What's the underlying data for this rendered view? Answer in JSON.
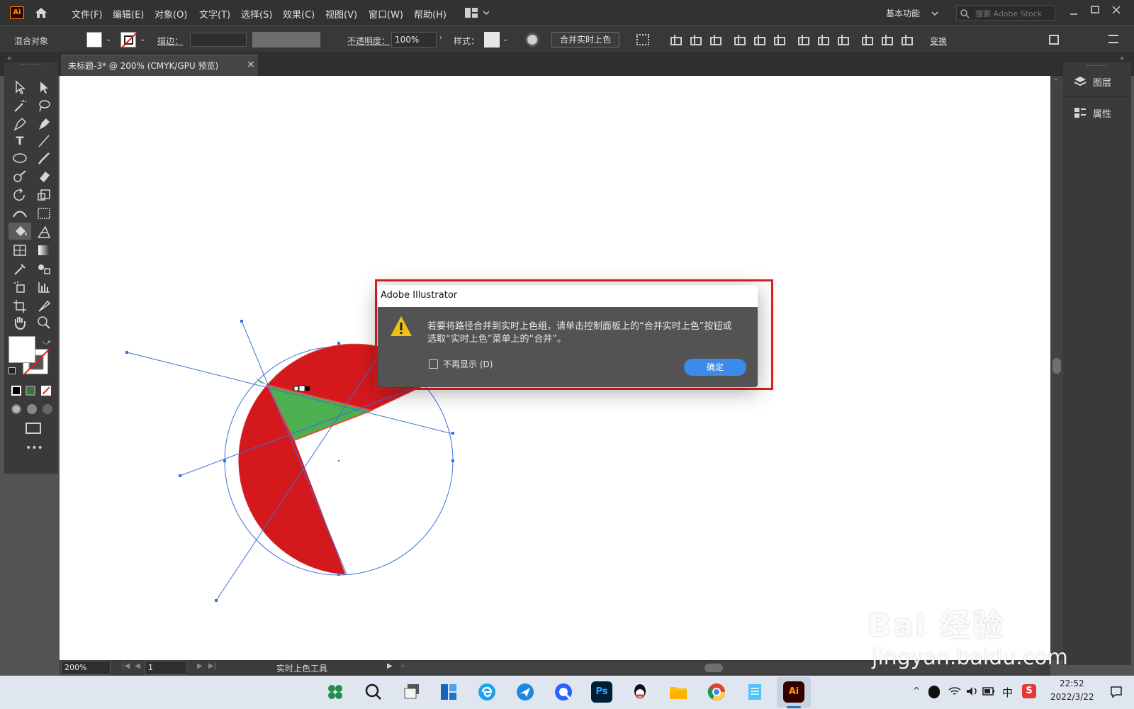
{
  "app": {
    "logo": "Ai",
    "workspace": "基本功能",
    "search_placeholder": "搜索 Adobe Stock"
  },
  "menu": [
    "文件(F)",
    "编辑(E)",
    "对象(O)",
    "文字(T)",
    "选择(S)",
    "效果(C)",
    "视图(V)",
    "窗口(W)",
    "帮助(H)"
  ],
  "control_bar": {
    "object_type": "混合对象",
    "stroke_label": "描边：",
    "opacity_label": "不透明度：",
    "opacity_value": "100%",
    "style_label": "样式：",
    "merge_button": "合并实时上色",
    "transform_label": "变换"
  },
  "document_tab": {
    "title": "未标题-3* @ 200% (CMYK/GPU 预览)",
    "close": "×"
  },
  "right_panel": {
    "layers_label": "图层",
    "properties_label": "属性"
  },
  "status_bar": {
    "zoom": "200%",
    "artboard_number": "1",
    "tool_name": "实时上色工具"
  },
  "dialog": {
    "title": "Adobe Illustrator",
    "message": "若要将路径合并到实时上色组，请单击控制面板上的“合并实时上色”按钮或选取“实时上色”菜单上的“合并”。",
    "checkbox_label": "不再显示 (D)",
    "ok_button": "确定",
    "accent_color": "#3c8bea",
    "highlight_color": "#e11e1e"
  },
  "artwork": {
    "fill_red": "#d4191c",
    "fill_green": "#4caf50",
    "path_blue": "#3d6ee0"
  },
  "taskbar": {
    "time": "22:52",
    "date": "2022/3/22",
    "ime": "中",
    "apps": [
      "start",
      "search",
      "task-view",
      "widgets",
      "edge",
      "feishu",
      "quark",
      "photoshop",
      "qq",
      "file-explorer",
      "chrome",
      "notepad",
      "illustrator"
    ],
    "illustrator_label": "Ai",
    "photoshop_label": "Ps"
  },
  "watermark": {
    "brand": "Bai 经验",
    "url": "jingyan.baidu.com"
  }
}
